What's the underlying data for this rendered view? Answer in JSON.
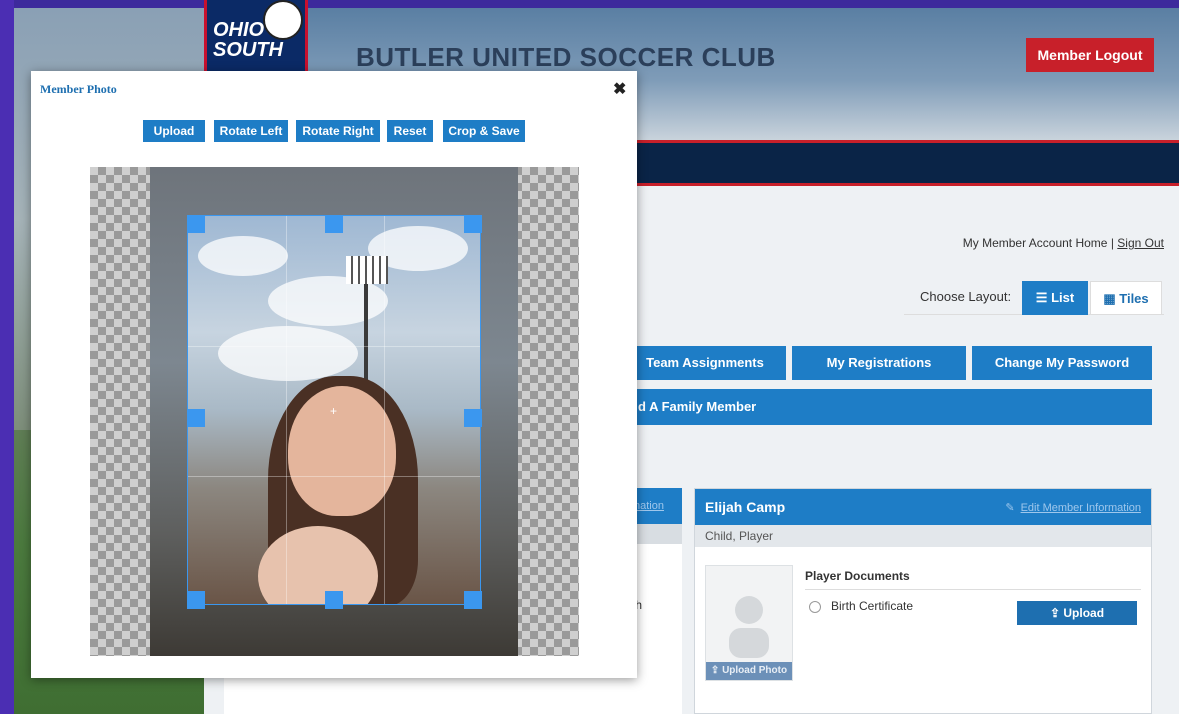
{
  "site": {
    "title": "BUTLER UNITED SOCCER CLUB",
    "logo_text": "OHIO SOUTH",
    "logout_label": "Member Logout",
    "home_link": "My Member Account Home",
    "separator": "|",
    "sign_out_link": "Sign Out",
    "layout_label": "Choose Layout:",
    "layout_list": "List",
    "layout_tiles": "Tiles",
    "actions": [
      "Team Assignments",
      "My Registrations",
      "Change My Password"
    ],
    "family_bar_label": "d A Family Member",
    "left_card_link": "nation",
    "left_card_text": "th"
  },
  "member_card": {
    "name": "Elijah Camp",
    "edit_label": "Edit Member Information",
    "role": "Child, Player",
    "upload_photo_label": "Upload Photo",
    "docs_title": "Player Documents",
    "doc_item": "Birth Certificate",
    "upload_label": "Upload"
  },
  "modal": {
    "title": "Member Photo",
    "close_glyph": "✖",
    "buttons": [
      "Upload",
      "Rotate Left",
      "Rotate Right",
      "Reset",
      "Crop & Save"
    ]
  },
  "colors": {
    "primary": "#1e7dc6",
    "logout": "#c8202a",
    "navbar": "#0a2447",
    "crop_border": "#3b97ef"
  }
}
